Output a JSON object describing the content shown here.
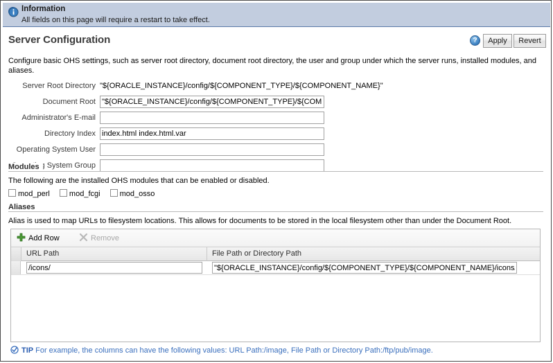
{
  "banner": {
    "icon": "info-circle-icon",
    "title": "Information",
    "text": "All fields on this page will require a restart to take effect."
  },
  "header": {
    "title": "Server Configuration",
    "help_icon": "help-question-icon",
    "help_glyph": "?",
    "apply_label": "Apply",
    "revert_label": "Revert"
  },
  "description": "Configure basic OHS settings, such as server root directory, document root directory, the user and group under which the server runs, installed modules, and aliases.",
  "form": {
    "fields": [
      {
        "label": "Server Root Directory",
        "value": "\"${ORACLE_INSTANCE}/config/${COMPONENT_TYPE}/${COMPONENT_NAME}\"",
        "readonly": true,
        "name": "server-root-directory"
      },
      {
        "label": "Document Root",
        "value": "\"${ORACLE_INSTANCE}/config/${COMPONENT_TYPE}/${COMPONENT_NAME}\"",
        "readonly": false,
        "name": "document-root"
      },
      {
        "label": "Administrator's E-mail",
        "value": "",
        "readonly": false,
        "name": "administrator-email"
      },
      {
        "label": "Directory Index",
        "value": "index.html index.html.var",
        "readonly": false,
        "name": "directory-index"
      },
      {
        "label": "Operating System User",
        "value": "",
        "readonly": false,
        "name": "operating-system-user"
      },
      {
        "label": "Operating System Group",
        "value": "",
        "readonly": false,
        "name": "operating-system-group"
      }
    ]
  },
  "modules": {
    "heading": "Modules",
    "description": "The following are the installed OHS modules that can be enabled or disabled.",
    "items": [
      {
        "label": "mod_perl",
        "checked": false
      },
      {
        "label": "mod_fcgi",
        "checked": false
      },
      {
        "label": "mod_osso",
        "checked": false
      }
    ]
  },
  "aliases": {
    "heading": "Aliases",
    "description": "Alias is used to map URLs to filesystem locations. This allows for documents to be stored in the local filesystem other than under the Document Root.",
    "toolbar": {
      "add_row_label": "Add Row",
      "add_row_icon": "plus-icon",
      "remove_label": "Remove",
      "remove_icon": "x-remove-icon",
      "remove_disabled": true
    },
    "columns": [
      "URL Path",
      "File Path or Directory Path"
    ],
    "rows": [
      {
        "url_path": "/icons/",
        "file_path": "\"${ORACLE_INSTANCE}/config/${COMPONENT_TYPE}/${COMPONENT_NAME}/icons/\""
      }
    ]
  },
  "tip": {
    "icon": "tip-check-icon",
    "label": "TIP",
    "text": "For example, the columns can have the following values: URL Path:/image, File Path or Directory Path:/ftp/pub/image."
  },
  "colors": {
    "banner_bg": "#c2cddf",
    "banner_border": "#5878a8",
    "tip_text": "#3a6fbd",
    "title_text": "#3b3b3b",
    "add_row_green": "#4a9a35"
  }
}
